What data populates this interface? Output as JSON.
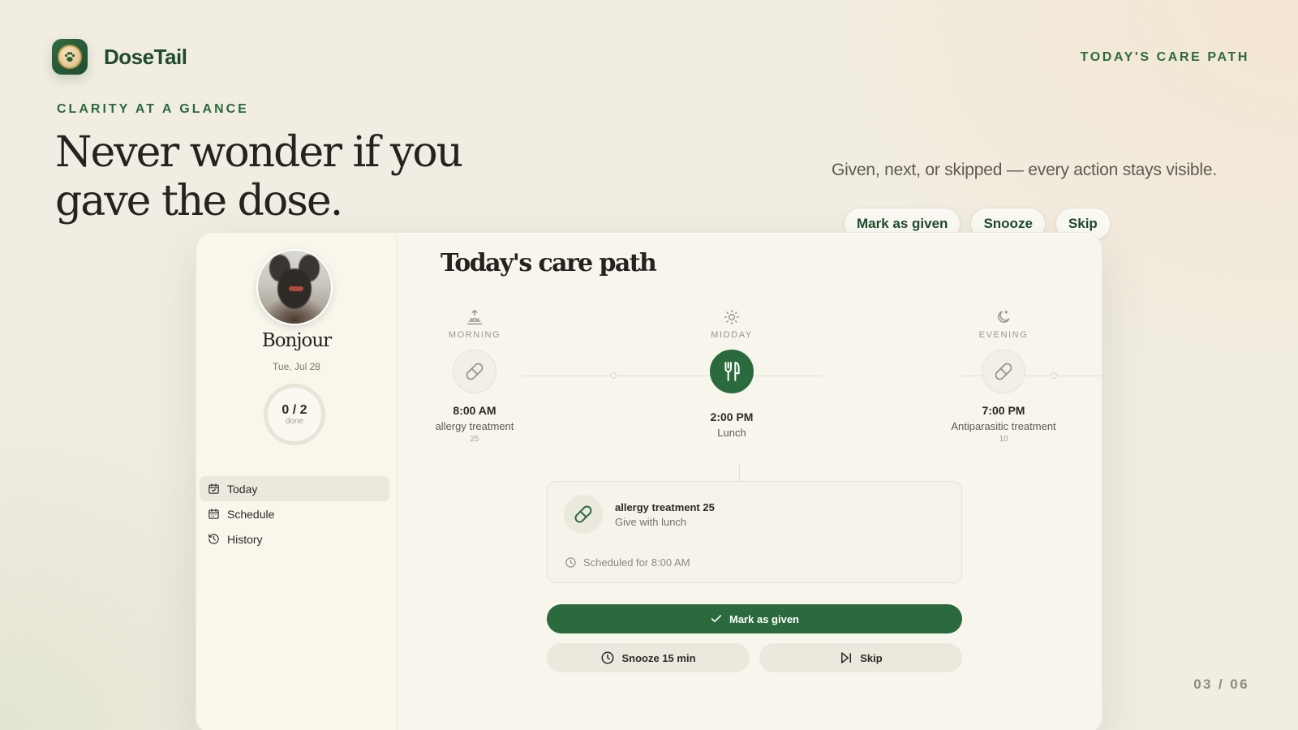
{
  "brand": {
    "name": "DoseTail",
    "icon": "paw-icon"
  },
  "top_link": "TODAY'S CARE PATH",
  "hero": {
    "eyebrow": "CLARITY AT A GLANCE",
    "headline": "Never wonder if you gave the dose.",
    "subtitle": "Given, next, or skipped — every action stays visible.",
    "chips": [
      "Mark as given",
      "Snooze",
      "Skip"
    ]
  },
  "pager": "03 / 06",
  "sidebar": {
    "greeting": "Bonjour",
    "date": "Tue, Jul 28",
    "progress": {
      "value": "0 / 2",
      "label": "done",
      "fraction": 0
    },
    "nav": [
      {
        "label": "Today",
        "icon": "calendar-check-icon",
        "active": true
      },
      {
        "label": "Schedule",
        "icon": "calendar-grid-icon",
        "active": false
      },
      {
        "label": "History",
        "icon": "history-icon",
        "active": false
      }
    ]
  },
  "main": {
    "title": "Today's care path",
    "slots": [
      {
        "period": "MORNING",
        "period_icon": "sunrise-icon",
        "node_icon": "pill-icon",
        "time": "8:00 AM",
        "med": "allergy treatment",
        "dose": "25",
        "active": false
      },
      {
        "period": "MIDDAY",
        "period_icon": "sun-icon",
        "node_icon": "fork-knife-icon",
        "time": "2:00 PM",
        "med": "Lunch",
        "dose": "",
        "active": true
      },
      {
        "period": "EVENING",
        "period_icon": "moon-icon",
        "node_icon": "pill-icon",
        "time": "7:00 PM",
        "med": "Antiparasitic treatment",
        "dose": "10",
        "active": false
      }
    ],
    "detail": {
      "name": "allergy treatment 25",
      "note": "Give with lunch",
      "scheduled": "Scheduled for 8:00 AM"
    },
    "actions": {
      "primary": "Mark as given",
      "snooze": "Snooze 15 min",
      "skip": "Skip"
    }
  },
  "colors": {
    "accent": "#2a6a3d",
    "brand_text": "#1f4a2c",
    "background": "#f1ede2"
  }
}
